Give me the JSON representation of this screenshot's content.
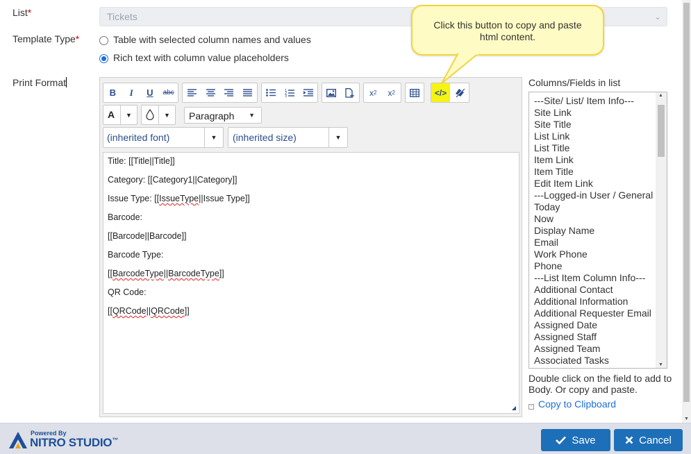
{
  "form": {
    "list_label": "List",
    "required_mark": "*",
    "list_value": "Tickets",
    "template_type_label": "Template Type",
    "template_options": [
      {
        "label": "Table with selected column names and values",
        "selected": false
      },
      {
        "label": "Rich text with column value placeholders",
        "selected": true
      }
    ],
    "print_format_label": "Print Format"
  },
  "editor": {
    "font_color_label": "A",
    "paragraph_label": "Paragraph",
    "font_value": "(inherited font)",
    "size_value": "(inherited size)",
    "toolbar_icons": [
      "bold-icon",
      "italic-icon",
      "underline-icon",
      "strikethrough-icon",
      "align-left-icon",
      "align-center-icon",
      "align-right-icon",
      "justify-icon",
      "bullet-list-icon",
      "numbered-list-icon",
      "indent-icon",
      "image-icon",
      "insert-file-icon",
      "subscript-icon",
      "superscript-icon",
      "table-icon",
      "html-source-icon",
      "clear-format-icon"
    ],
    "lines": [
      {
        "prefix": "Title: [[Title||Title]]"
      },
      {
        "prefix": "Category: [[Category1||Category]]"
      },
      {
        "prefix": "Issue Type: [[",
        "sq": "IssueType",
        "suffix": "||Issue Type]]"
      },
      {
        "prefix": "Barcode:"
      },
      {
        "prefix": "[[Barcode||Barcode]]"
      },
      {
        "prefix": "Barcode Type:"
      },
      {
        "prefix": "[[",
        "sq": "BarcodeType",
        "mid": "||",
        "sq2": "BarcodeType",
        "suffix": "]]"
      },
      {
        "prefix": "QR Code:"
      },
      {
        "prefix": "[[",
        "sq": "QRCode",
        "mid": "||",
        "sq2": "QRCode",
        "suffix": "]]"
      }
    ]
  },
  "columns": {
    "title": "Columns/Fields in list",
    "items": [
      "---Site/ List/ Item Info---",
      "Site Link",
      "Site Title",
      "List Link",
      "List Title",
      "Item Link",
      "Item Title",
      "Edit Item Link",
      "---Logged-in User / General",
      "Today",
      "Now",
      "Display Name",
      "Email",
      "Work Phone",
      "Phone",
      "---List Item Column Info---",
      "Additional Contact",
      "Additional Information",
      "Additional Requester Email",
      "Assigned Date",
      "Assigned Staff",
      "Assigned Team",
      "Associated Tasks",
      "Associated Tasks"
    ],
    "hint": "Double click on the field to add to Body. Or copy and paste.",
    "copy_link": "Copy to Clipboard"
  },
  "callout": {
    "text": "Click this button to copy and paste html content."
  },
  "footer": {
    "powered_by": "Powered By",
    "brand": "NITRO STUDIO",
    "trademark": "™",
    "save_label": "Save",
    "cancel_label": "Cancel"
  },
  "colors": {
    "accent": "#1d6fb8",
    "callout_bg": "#fffbc4",
    "highlight": "#f7f312",
    "required": "#cc0000"
  }
}
